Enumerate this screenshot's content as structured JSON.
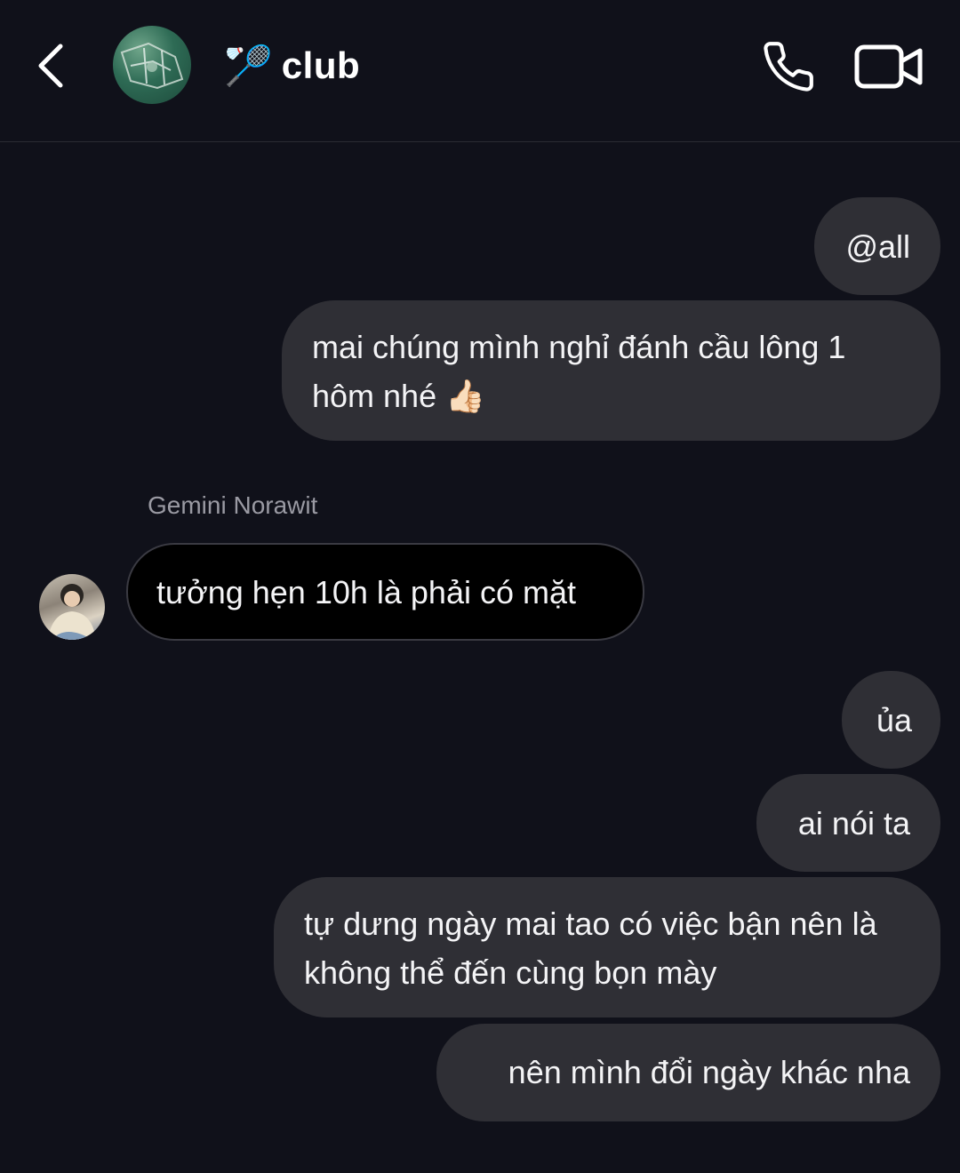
{
  "header": {
    "title": "club",
    "title_emoji": "🏸",
    "icons": {
      "back": "chevron-left-icon",
      "call": "phone-icon",
      "video": "video-camera-icon"
    }
  },
  "messages": [
    {
      "direction": "out",
      "text": "@all"
    },
    {
      "direction": "out",
      "text": "mai chúng mình nghỉ đánh cầu lông 1 hôm nhé 👍🏻"
    },
    {
      "direction": "in",
      "sender": "Gemini Norawit",
      "text": "tưởng hẹn 10h là phải có mặt"
    },
    {
      "direction": "out",
      "text": "ủa"
    },
    {
      "direction": "out",
      "text": "ai nói ta"
    },
    {
      "direction": "out",
      "text": "tự dưng ngày mai tao có việc bận nên là không thể đến cùng bọn mày"
    },
    {
      "direction": "out",
      "text": "nên mình đổi ngày khác nha"
    }
  ]
}
